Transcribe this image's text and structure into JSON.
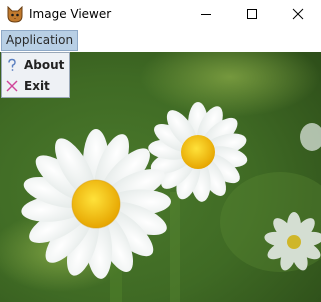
{
  "window": {
    "title": "Image Viewer"
  },
  "menubar": {
    "items": [
      {
        "label": "Application"
      }
    ]
  },
  "dropdown": {
    "items": [
      {
        "label": "About",
        "icon": "question-icon"
      },
      {
        "label": "Exit",
        "icon": "close-x-icon"
      }
    ]
  },
  "colors": {
    "menu_selected": "#b8cfe5",
    "question_icon": "#5a7fc0",
    "exit_icon": "#d0449a"
  },
  "image": {
    "subject": "daisy-flowers-photo"
  }
}
